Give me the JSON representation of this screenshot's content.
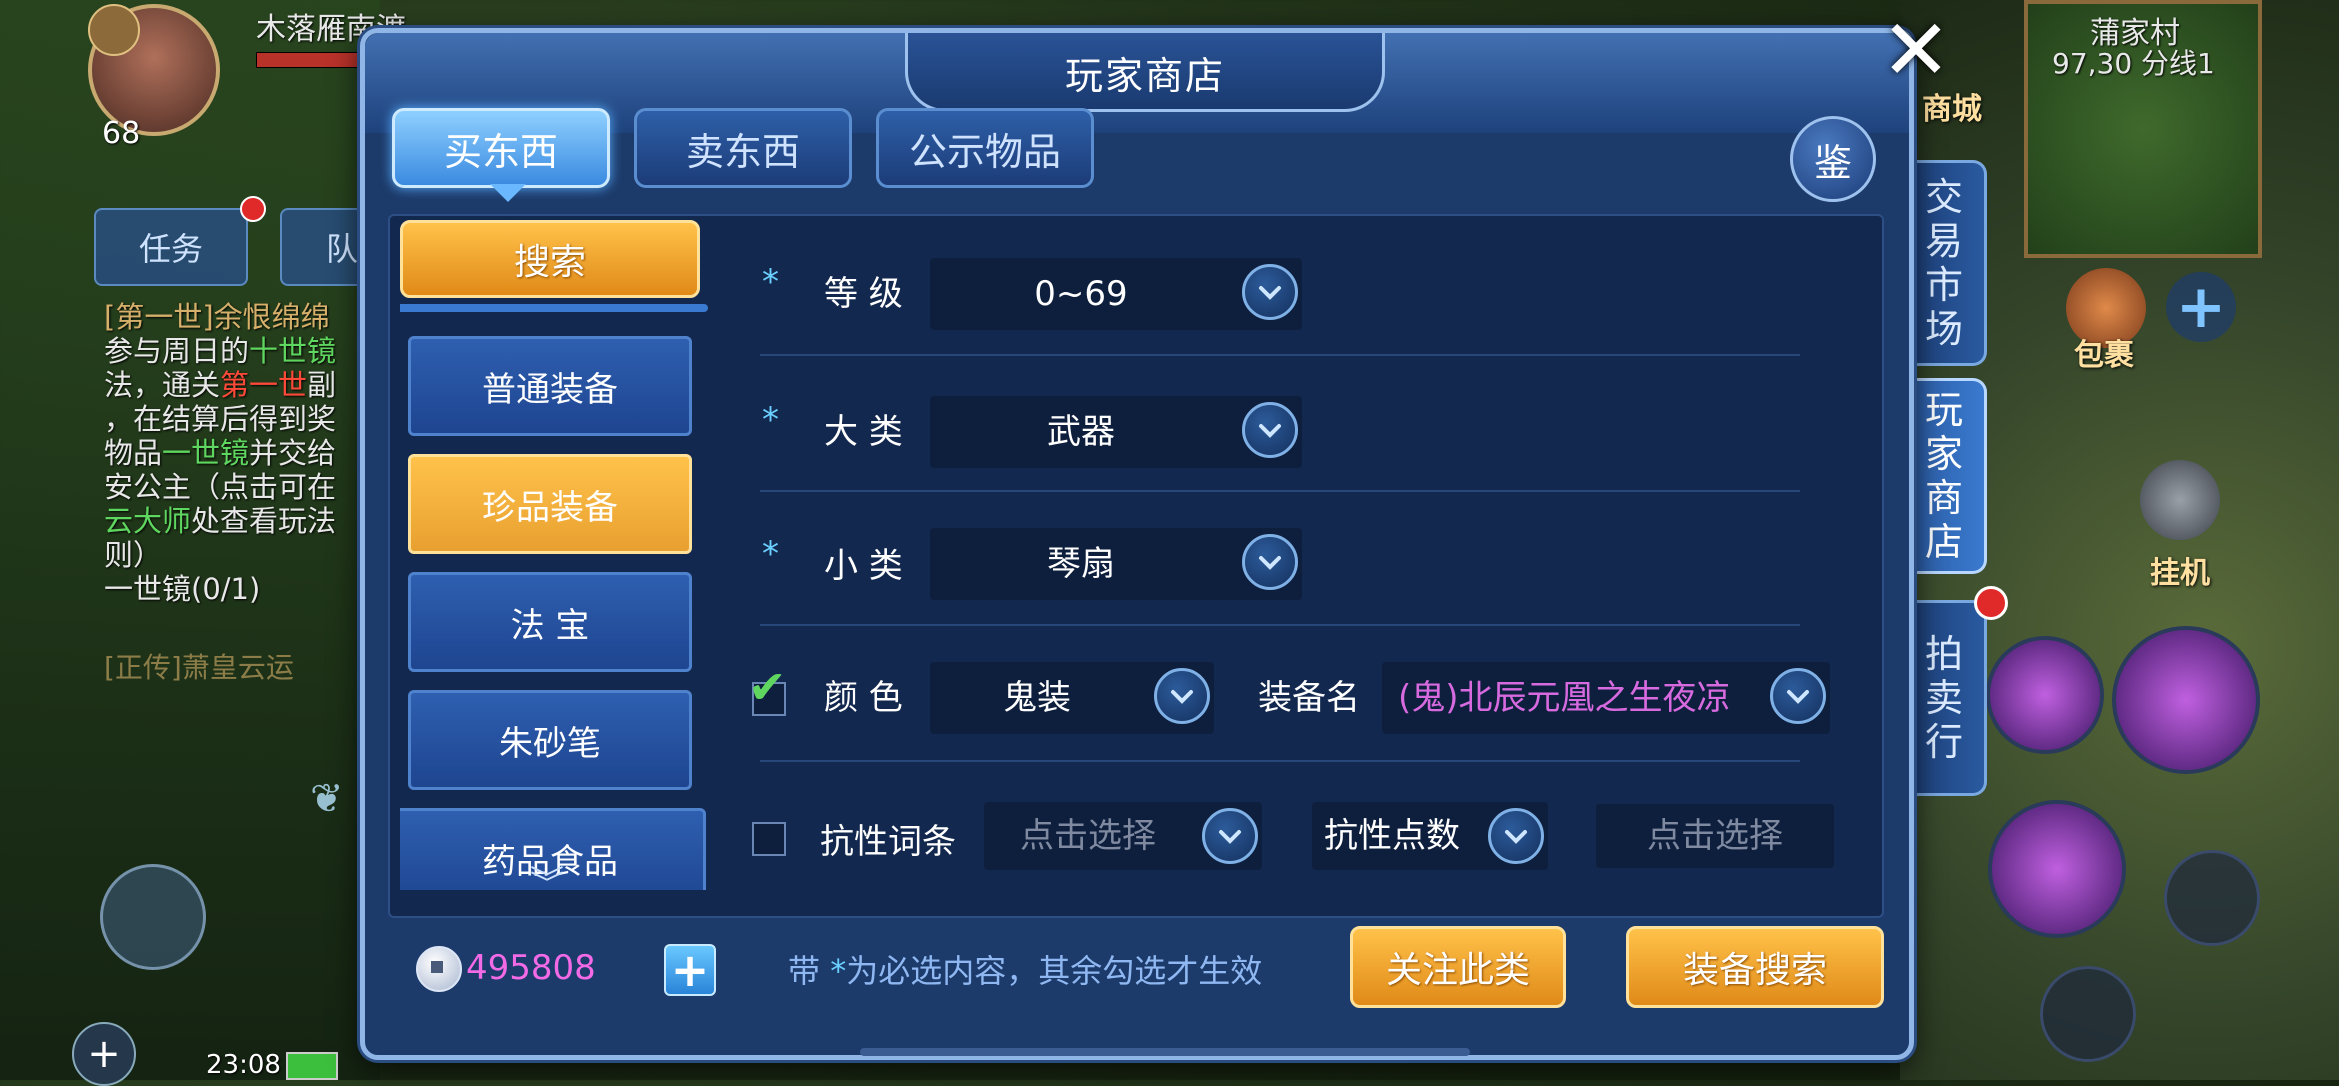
{
  "background": {
    "player_name": "木落雁南渡",
    "player_level": "68",
    "tabs": [
      "任务",
      "队"
    ],
    "quest_lines": [
      {
        "text": "[第一世]余恨绵绵",
        "style": "title"
      },
      {
        "text": "参与周日的",
        "style": "normal",
        "extra": "十世镜",
        "extra_style": "green"
      },
      {
        "text": "法，通关",
        "style": "normal",
        "extra": "第一世",
        "extra_style": "red",
        "tail": "副"
      },
      {
        "text": "，在结算后得到奖",
        "style": "normal"
      },
      {
        "text": "物品",
        "style": "normal",
        "extra": "一世镜",
        "extra_style": "green",
        "tail": "并交给"
      },
      {
        "text": "安公主（点击可在",
        "style": "normal"
      },
      {
        "text": "",
        "style": "normal",
        "extra": "云大师",
        "extra_style": "green",
        "tail": "处查看玩法"
      },
      {
        "text": "则）",
        "style": "normal"
      },
      {
        "text": "一世镜(0/1)",
        "style": "normal"
      }
    ],
    "quest_sub": "[正传]萧皇云运",
    "time": "23:08",
    "map_name": "蒲家村",
    "map_coord": "97,30 分线1",
    "mall_label": "商城",
    "bag_label": "包裹",
    "hangup_label": "挂机"
  },
  "side_tabs": [
    {
      "label": "交易市场",
      "active": false
    },
    {
      "label": "玩家商店",
      "active": true
    },
    {
      "label": "拍卖行",
      "active": false,
      "badge": true
    }
  ],
  "panel": {
    "title": "玩家商店",
    "close_icon": "close-icon",
    "tabs": [
      {
        "label": "买东西",
        "active": true
      },
      {
        "label": "卖东西",
        "active": false
      },
      {
        "label": "公示物品",
        "active": false
      }
    ],
    "appraise_label": "鉴",
    "search_label": "搜索",
    "categories": [
      {
        "label": "普通装备",
        "active": false
      },
      {
        "label": "珍品装备",
        "active": true
      },
      {
        "label": "法 宝",
        "active": false
      },
      {
        "label": "朱砂笔",
        "active": false
      },
      {
        "label": "药品食品",
        "active": false
      }
    ],
    "form": {
      "level": {
        "star": "*",
        "label": "等 级",
        "value": "0~69"
      },
      "major": {
        "star": "*",
        "label": "大 类",
        "value": "武器"
      },
      "minor": {
        "star": "*",
        "label": "小 类",
        "value": "琴扇"
      },
      "color": {
        "checked": true,
        "label": "颜 色",
        "value": "鬼装"
      },
      "equip_name": {
        "label": "装备名",
        "value": "(鬼)北辰元凰之生夜凉"
      },
      "resist_entry": {
        "checked": false,
        "label": "抗性词条",
        "placeholder": "点击选择"
      },
      "resist_points": {
        "label": "抗性点数",
        "placeholder": "点击选择"
      }
    },
    "currency": {
      "icon": "silver-coin-icon",
      "value": "495808"
    },
    "hint": {
      "prefix": "带 ",
      "star": "*",
      "suffix": "为必选内容，其余勾选才生效"
    },
    "follow_label": "关注此类",
    "equip_search_label": "装备搜索"
  },
  "colors": {
    "panel_bg": "#1c3a6a",
    "accent_orange": "#f0a030",
    "accent_blue": "#3a8ae0",
    "purple_text": "#d86ae0",
    "currency_pink": "#f36ae6"
  }
}
